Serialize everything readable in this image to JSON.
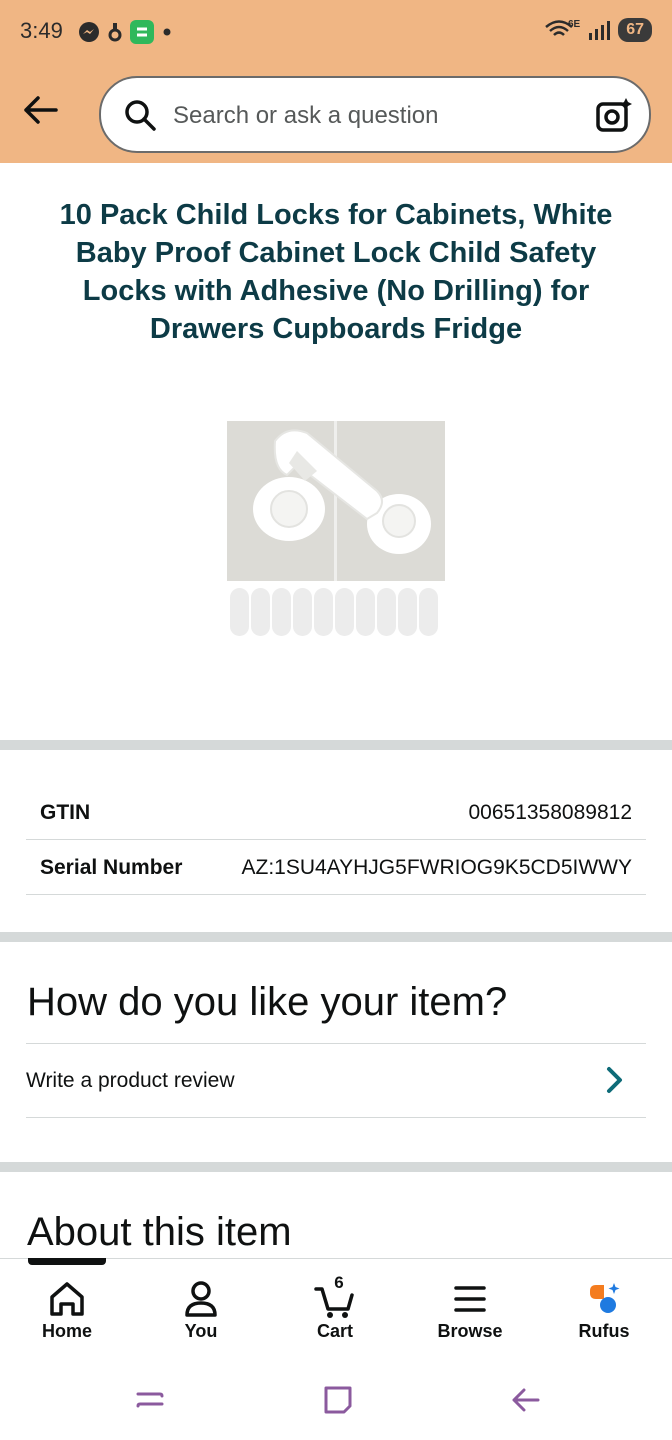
{
  "status_bar": {
    "time": "3:49",
    "network": "6E",
    "battery": "67"
  },
  "search": {
    "placeholder": "Search or ask a question"
  },
  "product": {
    "title": "10 Pack Child Locks for Cabinets, White Baby Proof Cabinet Lock Child Safety Locks with Adhesive (No Drilling) for Drawers Cupboards Fridge"
  },
  "details": [
    {
      "label": "GTIN",
      "value": "00651358089812"
    },
    {
      "label": "Serial Number",
      "value": "AZ:1SU4AYHJG5FWRIOG9K5CD5IWWY"
    }
  ],
  "review_section": {
    "heading": "How do you like your item?",
    "write_review_label": "Write a product review"
  },
  "about_section": {
    "heading": "About this item"
  },
  "bottom_nav": {
    "items": [
      {
        "label": "Home",
        "icon": "home-icon"
      },
      {
        "label": "You",
        "icon": "person-icon"
      },
      {
        "label": "Cart",
        "icon": "cart-icon"
      },
      {
        "label": "Browse",
        "icon": "menu-icon"
      },
      {
        "label": "Rufus",
        "icon": "rufus-icon"
      }
    ],
    "cart_count": "6"
  },
  "colors": {
    "header_bg": "#f0b684",
    "title_color": "#0d3b46",
    "accent_teal": "#007185"
  }
}
